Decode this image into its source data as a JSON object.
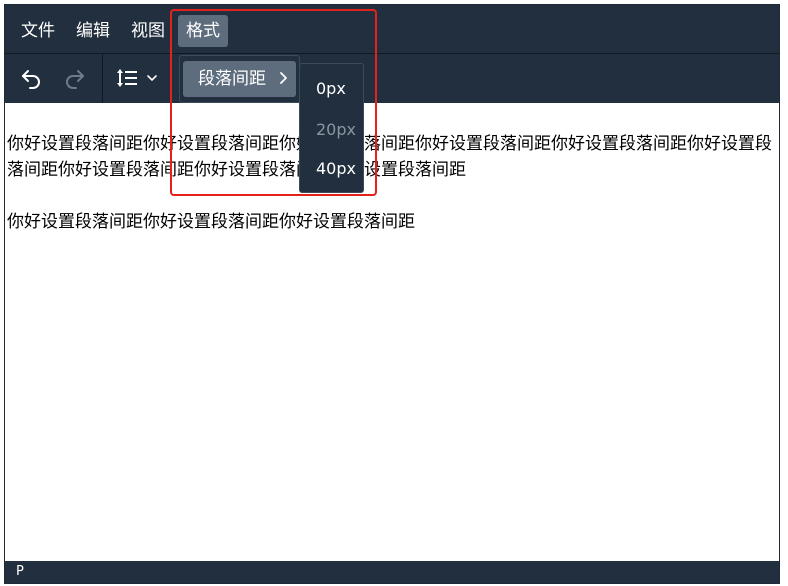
{
  "menubar": {
    "items": [
      {
        "label": "文件"
      },
      {
        "label": "编辑"
      },
      {
        "label": "视图"
      },
      {
        "label": "格式"
      }
    ]
  },
  "toolbar": {
    "buttons": [
      {
        "icon": "undo-icon"
      },
      {
        "icon": "redo-icon"
      },
      {
        "icon": "line-height-icon"
      }
    ]
  },
  "format_menu": {
    "item_label": "段落间距"
  },
  "spacing_menu": {
    "options": [
      {
        "label": "0px",
        "disabled": false
      },
      {
        "label": "20px",
        "disabled": true
      },
      {
        "label": "40px",
        "disabled": false
      }
    ]
  },
  "content": {
    "paragraphs": [
      "你好设置段落间距你好设置段落间距你好设置段落间距你好设置段落间距你好设置段落间距你好设置段落间距你好设置段落间距你好设置段落间距你好设置段落间距",
      "你好设置段落间距你好设置段落间距你好设置段落间距"
    ]
  },
  "statusbar": {
    "path": "P"
  },
  "colors": {
    "chrome_bg": "#222f3e",
    "active_bg": "#5e6d7e",
    "highlight": "#e5211b",
    "disabled_text": "#8a95a2"
  }
}
